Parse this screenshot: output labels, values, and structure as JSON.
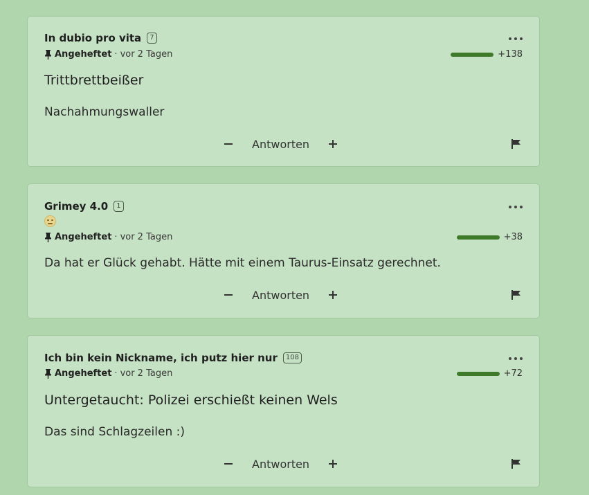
{
  "posts": [
    {
      "author": "In dubio pro vita",
      "count": "7",
      "pinned_label": "Angeheftet",
      "separator": "·",
      "time": "vor 2 Tagen",
      "rating": "+138",
      "rating_fraction": 1.0,
      "title": "Trittbrettbeißer",
      "body": "Nachahmungswaller",
      "reply_label": "Antworten",
      "has_emoji": false
    },
    {
      "author": "Grimey 4.0",
      "count": "1",
      "pinned_label": "Angeheftet",
      "separator": "·",
      "time": "vor 2 Tagen",
      "rating": "+38",
      "rating_fraction": 1.0,
      "title": "",
      "body": "Da hat er Glück gehabt. Hätte mit einem Taurus-Einsatz gerechnet.",
      "reply_label": "Antworten",
      "has_emoji": true,
      "emoji": "frowning-face-icon"
    },
    {
      "author": "Ich bin kein Nickname, ich putz hier nur",
      "count": "108",
      "pinned_label": "Angeheftet",
      "separator": "·",
      "time": "vor 2 Tagen",
      "rating": "+72",
      "rating_fraction": 1.0,
      "title": "Untergetaucht: Polizei erschießt keinen Wels",
      "body": "Das sind Schlagzeilen :)",
      "reply_label": "Antworten",
      "has_emoji": false
    }
  ],
  "colors": {
    "background": "#b0d6ad",
    "card": "#c6e2c4",
    "rating_bar": "#3f7a2a"
  }
}
